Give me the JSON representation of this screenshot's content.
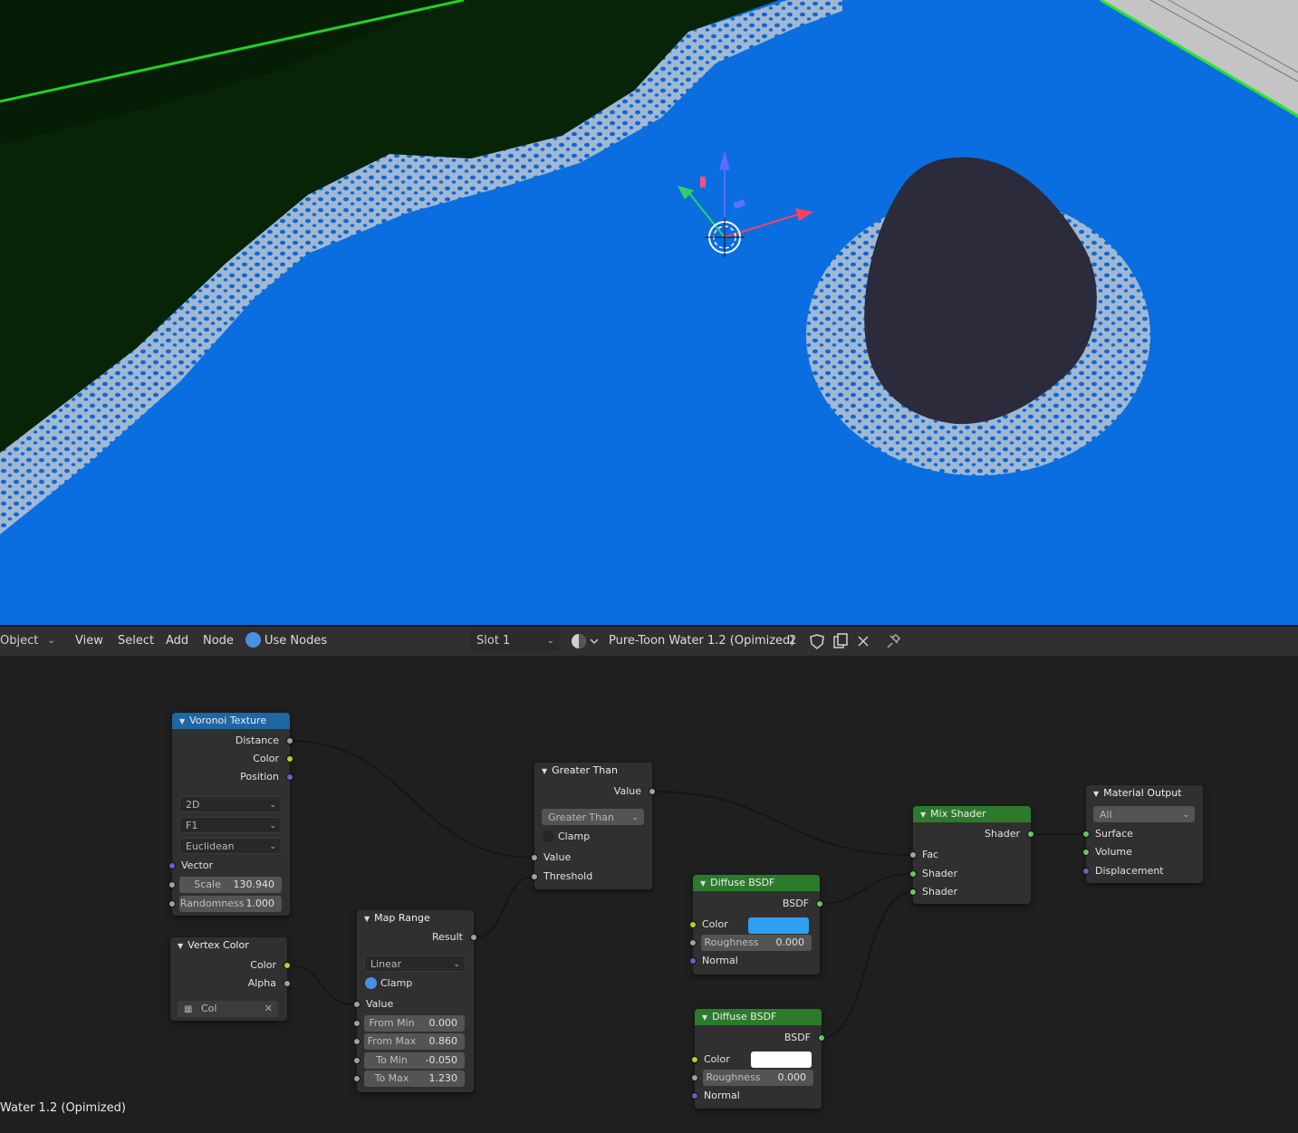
{
  "header": {
    "mode": "Object",
    "menu": [
      "View",
      "Select",
      "Add",
      "Node"
    ],
    "use_nodes": "Use Nodes",
    "slot": "Slot 1",
    "material_name": "Pure-Toon Water 1.2 (Opimized)",
    "user_count": "2"
  },
  "nodes": {
    "voronoi": {
      "title": "Voronoi Texture",
      "outputs": [
        "Distance",
        "Color",
        "Position"
      ],
      "dimensions": "2D",
      "feature": "F1",
      "metric": "Euclidean",
      "inputs": [
        "Vector"
      ],
      "scale_label": "Scale",
      "scale_value": "130.940",
      "randomness_label": "Randomness",
      "randomness_value": "1.000"
    },
    "vertex_color": {
      "title": "Vertex Color",
      "outputs": [
        "Color",
        "Alpha"
      ],
      "layer": "Col"
    },
    "map_range": {
      "title": "Map Range",
      "output": "Result",
      "interpolation": "Linear",
      "clamp": "Clamp",
      "input": "Value",
      "fields": [
        {
          "label": "From Min",
          "value": "0.000"
        },
        {
          "label": "From Max",
          "value": "0.860"
        },
        {
          "label": "To Min",
          "value": "-0.050"
        },
        {
          "label": "To Max",
          "value": "1.230"
        }
      ]
    },
    "greater_than": {
      "title": "Greater Than",
      "output": "Value",
      "operation": "Greater Than",
      "clamp": "Clamp",
      "inputs": [
        "Value",
        "Threshold"
      ]
    },
    "diffuse1": {
      "title": "Diffuse BSDF",
      "output": "BSDF",
      "color_label": "Color",
      "color": "#2f9ff0",
      "roughness_label": "Roughness",
      "roughness_value": "0.000",
      "normal": "Normal"
    },
    "diffuse2": {
      "title": "Diffuse BSDF",
      "output": "BSDF",
      "color_label": "Color",
      "color": "#ffffff",
      "roughness_label": "Roughness",
      "roughness_value": "0.000",
      "normal": "Normal"
    },
    "mix_shader": {
      "title": "Mix Shader",
      "output": "Shader",
      "inputs": [
        "Fac",
        "Shader",
        "Shader"
      ]
    },
    "material_output": {
      "title": "Material Output",
      "target": "All",
      "inputs": [
        "Surface",
        "Volume",
        "Displacement"
      ]
    }
  },
  "status_label": "Water 1.2 (Opimized)",
  "colors": {
    "water": "#0a6ee0",
    "foam": "#9fb8d4",
    "rock": "#2b2b3b",
    "grass": "#072407",
    "header_blue": "#1f66a4",
    "header_green": "#2c7a2c"
  }
}
